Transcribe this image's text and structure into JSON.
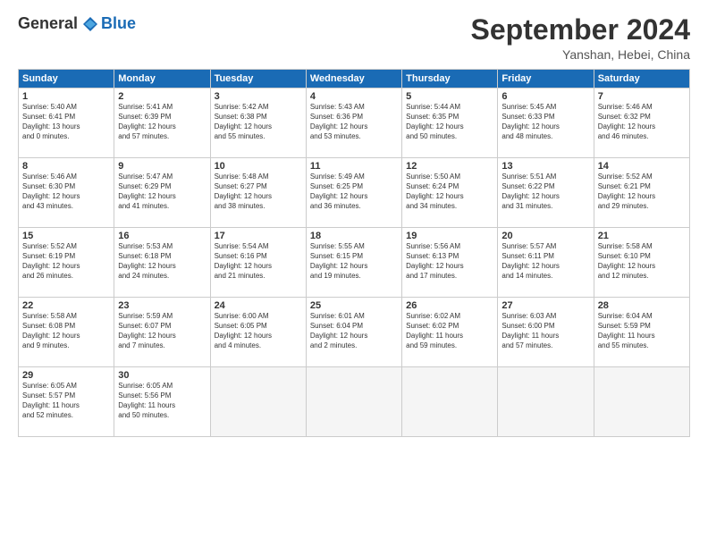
{
  "header": {
    "logo_general": "General",
    "logo_blue": "Blue",
    "month_title": "September 2024",
    "subtitle": "Yanshan, Hebei, China"
  },
  "days_of_week": [
    "Sunday",
    "Monday",
    "Tuesday",
    "Wednesday",
    "Thursday",
    "Friday",
    "Saturday"
  ],
  "weeks": [
    [
      {
        "day": "1",
        "info": "Sunrise: 5:40 AM\nSunset: 6:41 PM\nDaylight: 13 hours\nand 0 minutes."
      },
      {
        "day": "2",
        "info": "Sunrise: 5:41 AM\nSunset: 6:39 PM\nDaylight: 12 hours\nand 57 minutes."
      },
      {
        "day": "3",
        "info": "Sunrise: 5:42 AM\nSunset: 6:38 PM\nDaylight: 12 hours\nand 55 minutes."
      },
      {
        "day": "4",
        "info": "Sunrise: 5:43 AM\nSunset: 6:36 PM\nDaylight: 12 hours\nand 53 minutes."
      },
      {
        "day": "5",
        "info": "Sunrise: 5:44 AM\nSunset: 6:35 PM\nDaylight: 12 hours\nand 50 minutes."
      },
      {
        "day": "6",
        "info": "Sunrise: 5:45 AM\nSunset: 6:33 PM\nDaylight: 12 hours\nand 48 minutes."
      },
      {
        "day": "7",
        "info": "Sunrise: 5:46 AM\nSunset: 6:32 PM\nDaylight: 12 hours\nand 46 minutes."
      }
    ],
    [
      {
        "day": "8",
        "info": "Sunrise: 5:46 AM\nSunset: 6:30 PM\nDaylight: 12 hours\nand 43 minutes."
      },
      {
        "day": "9",
        "info": "Sunrise: 5:47 AM\nSunset: 6:29 PM\nDaylight: 12 hours\nand 41 minutes."
      },
      {
        "day": "10",
        "info": "Sunrise: 5:48 AM\nSunset: 6:27 PM\nDaylight: 12 hours\nand 38 minutes."
      },
      {
        "day": "11",
        "info": "Sunrise: 5:49 AM\nSunset: 6:25 PM\nDaylight: 12 hours\nand 36 minutes."
      },
      {
        "day": "12",
        "info": "Sunrise: 5:50 AM\nSunset: 6:24 PM\nDaylight: 12 hours\nand 34 minutes."
      },
      {
        "day": "13",
        "info": "Sunrise: 5:51 AM\nSunset: 6:22 PM\nDaylight: 12 hours\nand 31 minutes."
      },
      {
        "day": "14",
        "info": "Sunrise: 5:52 AM\nSunset: 6:21 PM\nDaylight: 12 hours\nand 29 minutes."
      }
    ],
    [
      {
        "day": "15",
        "info": "Sunrise: 5:52 AM\nSunset: 6:19 PM\nDaylight: 12 hours\nand 26 minutes."
      },
      {
        "day": "16",
        "info": "Sunrise: 5:53 AM\nSunset: 6:18 PM\nDaylight: 12 hours\nand 24 minutes."
      },
      {
        "day": "17",
        "info": "Sunrise: 5:54 AM\nSunset: 6:16 PM\nDaylight: 12 hours\nand 21 minutes."
      },
      {
        "day": "18",
        "info": "Sunrise: 5:55 AM\nSunset: 6:15 PM\nDaylight: 12 hours\nand 19 minutes."
      },
      {
        "day": "19",
        "info": "Sunrise: 5:56 AM\nSunset: 6:13 PM\nDaylight: 12 hours\nand 17 minutes."
      },
      {
        "day": "20",
        "info": "Sunrise: 5:57 AM\nSunset: 6:11 PM\nDaylight: 12 hours\nand 14 minutes."
      },
      {
        "day": "21",
        "info": "Sunrise: 5:58 AM\nSunset: 6:10 PM\nDaylight: 12 hours\nand 12 minutes."
      }
    ],
    [
      {
        "day": "22",
        "info": "Sunrise: 5:58 AM\nSunset: 6:08 PM\nDaylight: 12 hours\nand 9 minutes."
      },
      {
        "day": "23",
        "info": "Sunrise: 5:59 AM\nSunset: 6:07 PM\nDaylight: 12 hours\nand 7 minutes."
      },
      {
        "day": "24",
        "info": "Sunrise: 6:00 AM\nSunset: 6:05 PM\nDaylight: 12 hours\nand 4 minutes."
      },
      {
        "day": "25",
        "info": "Sunrise: 6:01 AM\nSunset: 6:04 PM\nDaylight: 12 hours\nand 2 minutes."
      },
      {
        "day": "26",
        "info": "Sunrise: 6:02 AM\nSunset: 6:02 PM\nDaylight: 11 hours\nand 59 minutes."
      },
      {
        "day": "27",
        "info": "Sunrise: 6:03 AM\nSunset: 6:00 PM\nDaylight: 11 hours\nand 57 minutes."
      },
      {
        "day": "28",
        "info": "Sunrise: 6:04 AM\nSunset: 5:59 PM\nDaylight: 11 hours\nand 55 minutes."
      }
    ],
    [
      {
        "day": "29",
        "info": "Sunrise: 6:05 AM\nSunset: 5:57 PM\nDaylight: 11 hours\nand 52 minutes."
      },
      {
        "day": "30",
        "info": "Sunrise: 6:05 AM\nSunset: 5:56 PM\nDaylight: 11 hours\nand 50 minutes."
      },
      {
        "day": "",
        "info": ""
      },
      {
        "day": "",
        "info": ""
      },
      {
        "day": "",
        "info": ""
      },
      {
        "day": "",
        "info": ""
      },
      {
        "day": "",
        "info": ""
      }
    ]
  ]
}
